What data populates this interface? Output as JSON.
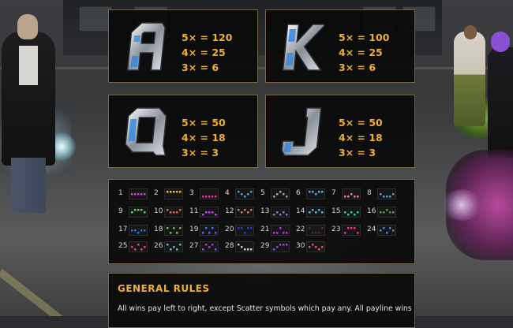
{
  "symbols": [
    {
      "id": "A",
      "icon": "letter-a-icon",
      "pays": [
        "5× = 120",
        "4× = 25",
        "3× = 6"
      ]
    },
    {
      "id": "K",
      "icon": "letter-k-icon",
      "pays": [
        "5× = 100",
        "4× = 25",
        "3× = 6"
      ]
    },
    {
      "id": "Q",
      "icon": "letter-q-icon",
      "pays": [
        "5× = 50",
        "4× = 18",
        "3× = 3"
      ]
    },
    {
      "id": "J",
      "icon": "letter-j-icon",
      "pays": [
        "5× = 50",
        "4× = 18",
        "3× = 3"
      ]
    }
  ],
  "paylines": {
    "labels": [
      "1",
      "2",
      "3",
      "4",
      "5",
      "6",
      "7",
      "8",
      "9",
      "10",
      "11",
      "12",
      "13",
      "14",
      "15",
      "16",
      "17",
      "18",
      "19",
      "20",
      "21",
      "22",
      "23",
      "24",
      "25",
      "26",
      "27",
      "28",
      "29",
      "30"
    ],
    "colors": [
      "#d23bd6",
      "#f0c020",
      "#d03a9a",
      "#4aa0d8",
      "#a4a4a4",
      "#46b8e0",
      "#e87bb0",
      "#3ea4e6",
      "#5ad35a",
      "#e06a2a",
      "#c04adc",
      "#e07070",
      "#9a68c8",
      "#4ac0e0",
      "#3ec6a8",
      "#4aa040",
      "#2a76c8",
      "#7ab850",
      "#4a6ae0",
      "#2a3ad0",
      "#a040d0",
      "#5a2a2a",
      "#e03a8a",
      "#3a8ae0",
      "#e0407a",
      "#48c0c8",
      "#8a4ad0",
      "#c0c0e0",
      "#8a48d8",
      "#e05050"
    ]
  },
  "rules": {
    "title": "GENERAL RULES",
    "text": "All wins pay left to right, except Scatter symbols which pay any. All payline wins"
  },
  "colors": {
    "accent": "#f0b12a",
    "panel_border": "#7a6a4a"
  }
}
